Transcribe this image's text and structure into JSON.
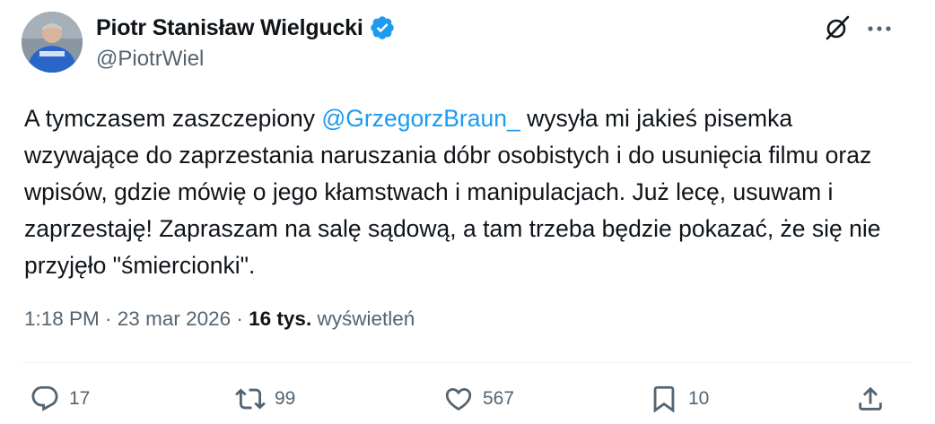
{
  "author": {
    "display_name": "Piotr Stanisław Wielgucki",
    "handle": "@PiotrWiel",
    "verified": true,
    "verified_color": "#1d9bf0"
  },
  "tweet": {
    "text_before": "A tymczasem zaszczepiony ",
    "mention": "@GrzegorzBraun_",
    "text_after": " wysyła mi jakieś pisemka wzywające do zaprzestania naruszania dóbr osobistych i do usunięcia filmu oraz wpisów, gdzie mówię o jego kłamstwach i manipulacjach. Już lecę, usuwam i zaprzestaję! Zapraszam na salę sądową, a tam trzeba będzie pokazać, że się nie przyjęło \"śmiercionki\"."
  },
  "meta": {
    "time": "1:18 PM",
    "separator": " · ",
    "date": "23 mar 2026",
    "separator2": " · ",
    "views_count": "16 tys.",
    "views_label": " wyświetleń"
  },
  "actions": {
    "replies": "17",
    "reposts": "99",
    "likes": "567",
    "bookmarks": "10"
  },
  "icons": {
    "grok": "grok-icon",
    "more": "more-icon",
    "reply": "reply-icon",
    "repost": "repost-icon",
    "like": "heart-icon",
    "bookmark": "bookmark-icon",
    "share": "share-icon"
  },
  "colors": {
    "text": "#0f1419",
    "secondary": "#536471",
    "accent": "#1d9bf0"
  }
}
